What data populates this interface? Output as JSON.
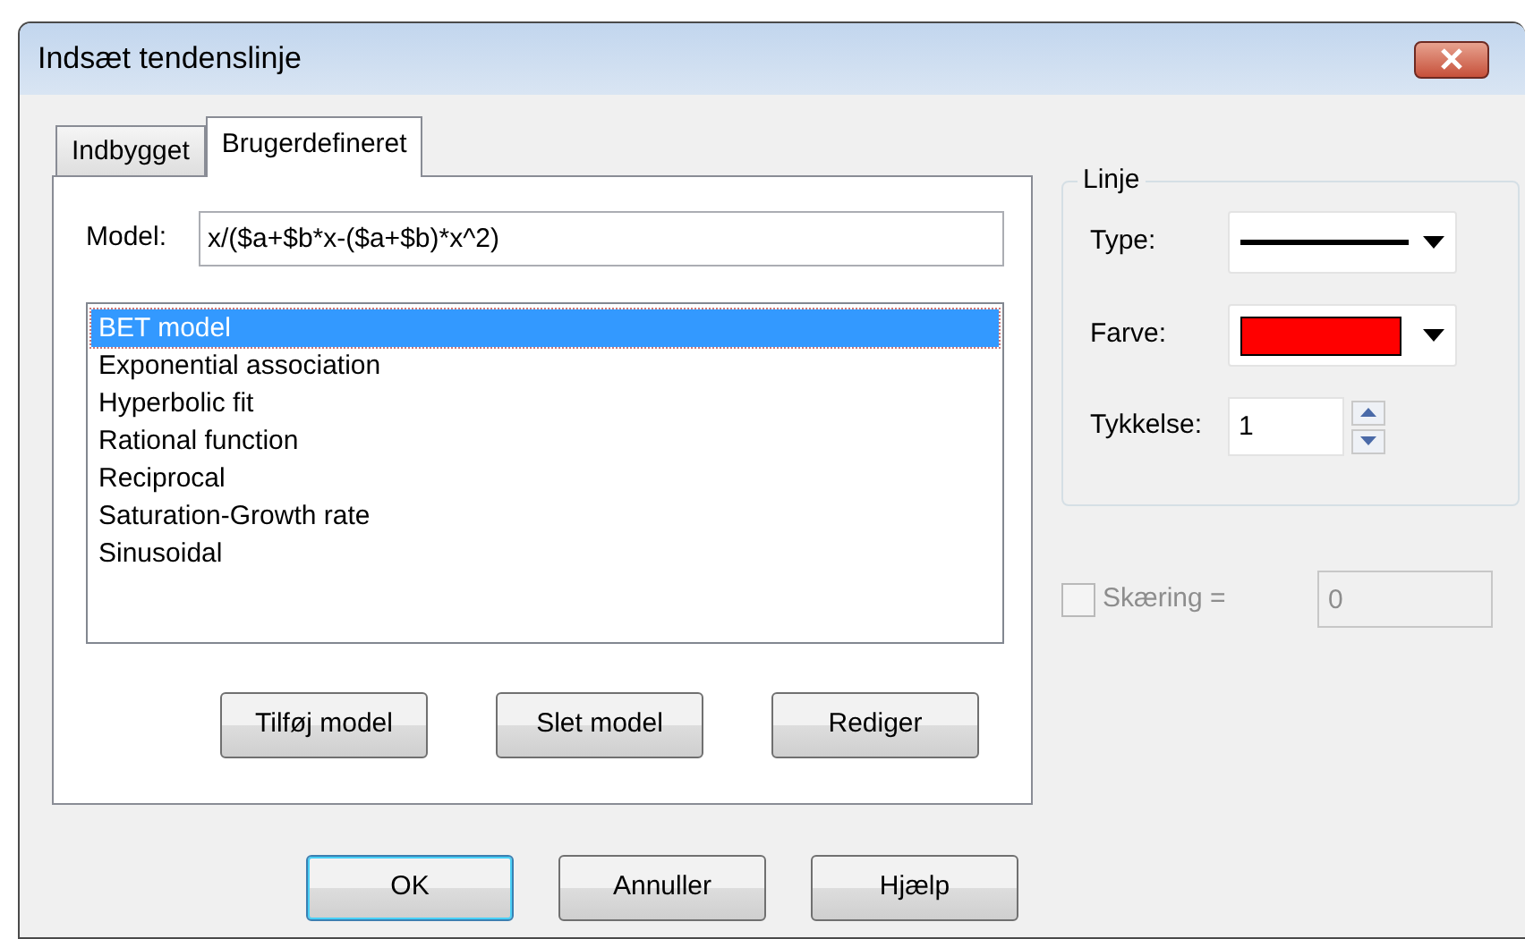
{
  "window": {
    "title": "Indsæt tendenslinje"
  },
  "tabs": [
    {
      "label": "Indbygget",
      "selected": false
    },
    {
      "label": "Brugerdefineret",
      "selected": true
    }
  ],
  "model": {
    "label": "Model:",
    "value": "x/($a+$b*x-($a+$b)*x^2)"
  },
  "models": [
    {
      "label": "BET model",
      "selected": true
    },
    {
      "label": "Exponential association",
      "selected": false
    },
    {
      "label": "Hyperbolic fit",
      "selected": false
    },
    {
      "label": "Rational function",
      "selected": false
    },
    {
      "label": "Reciprocal",
      "selected": false
    },
    {
      "label": "Saturation-Growth rate",
      "selected": false
    },
    {
      "label": "Sinusoidal",
      "selected": false
    }
  ],
  "model_buttons": [
    "Tilføj model",
    "Slet model",
    "Rediger"
  ],
  "line_group": {
    "title": "Linje",
    "type_label": "Type:",
    "color_label": "Farve:",
    "color": "#ff0000",
    "thickness_label": "Tykkelse:",
    "thickness": "1"
  },
  "intercept": {
    "label": "Skæring =",
    "checked": false,
    "disabled": true,
    "value": "0"
  },
  "buttons": [
    {
      "label": "OK",
      "default": true
    },
    {
      "label": "Annuller",
      "default": false
    },
    {
      "label": "Hjælp",
      "default": false
    }
  ]
}
